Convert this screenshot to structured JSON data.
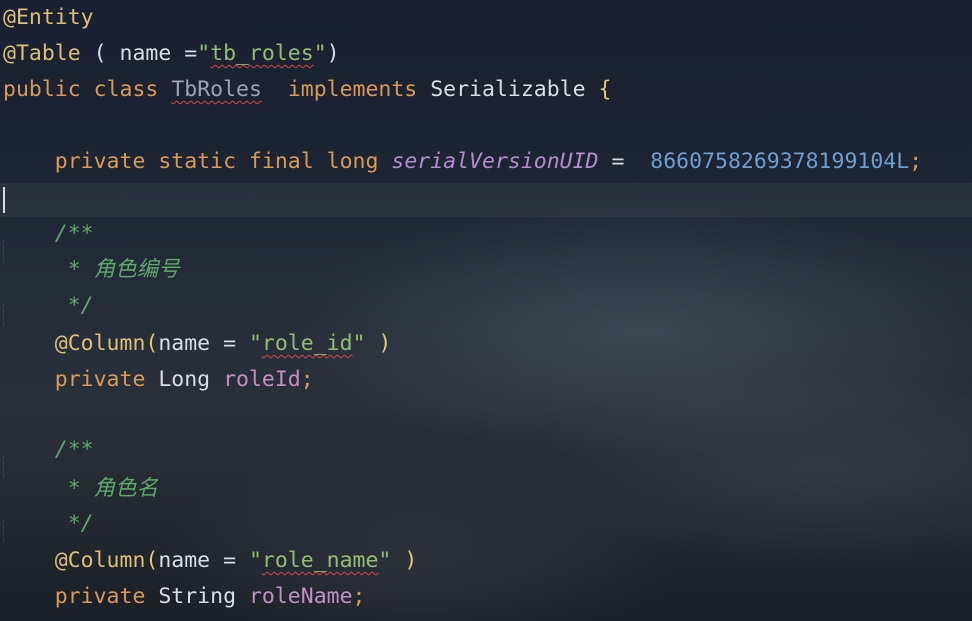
{
  "code": {
    "l1": {
      "annotation": "@Entity"
    },
    "l2": {
      "annotation": "@Table",
      "open": " ( ",
      "attr": "name",
      "eq": " =",
      "q1": "\"",
      "value": "tb_roles",
      "q2": "\"",
      "close": ")"
    },
    "l3": {
      "kw1": "public",
      "kw2": "class",
      "class_name": "TbRoles",
      "kw3": "implements",
      "iface": "Serializable",
      "brace": "{"
    },
    "l5": {
      "kw1": "private",
      "kw2": "static",
      "kw3": "final",
      "kw4": "long",
      "field": "serialVersionUID",
      "eq": " =  ",
      "number": "8660758269378199104L",
      "semi": ";"
    },
    "c1": {
      "open": "/**",
      "text": " * 角色编号",
      "close": " */"
    },
    "l10": {
      "annotation": "@Column",
      "paren": "(",
      "attr": "name",
      "eq": " = ",
      "q1": "\"",
      "value": "role_id",
      "q2": "\"",
      "close": " )"
    },
    "l11": {
      "kw": "private",
      "type": "Long",
      "field": "roleId",
      "semi": ";"
    },
    "c2": {
      "open": "/**",
      "text": " * 角色名",
      "close": " */"
    },
    "l16": {
      "annotation": "@Column",
      "paren": "(",
      "attr": "name",
      "eq": " = ",
      "q1": "\"",
      "value": "role_name",
      "q2": "\"",
      "close": " )"
    },
    "l17": {
      "kw": "private",
      "type": "String",
      "field": "roleName",
      "semi": ";"
    }
  }
}
